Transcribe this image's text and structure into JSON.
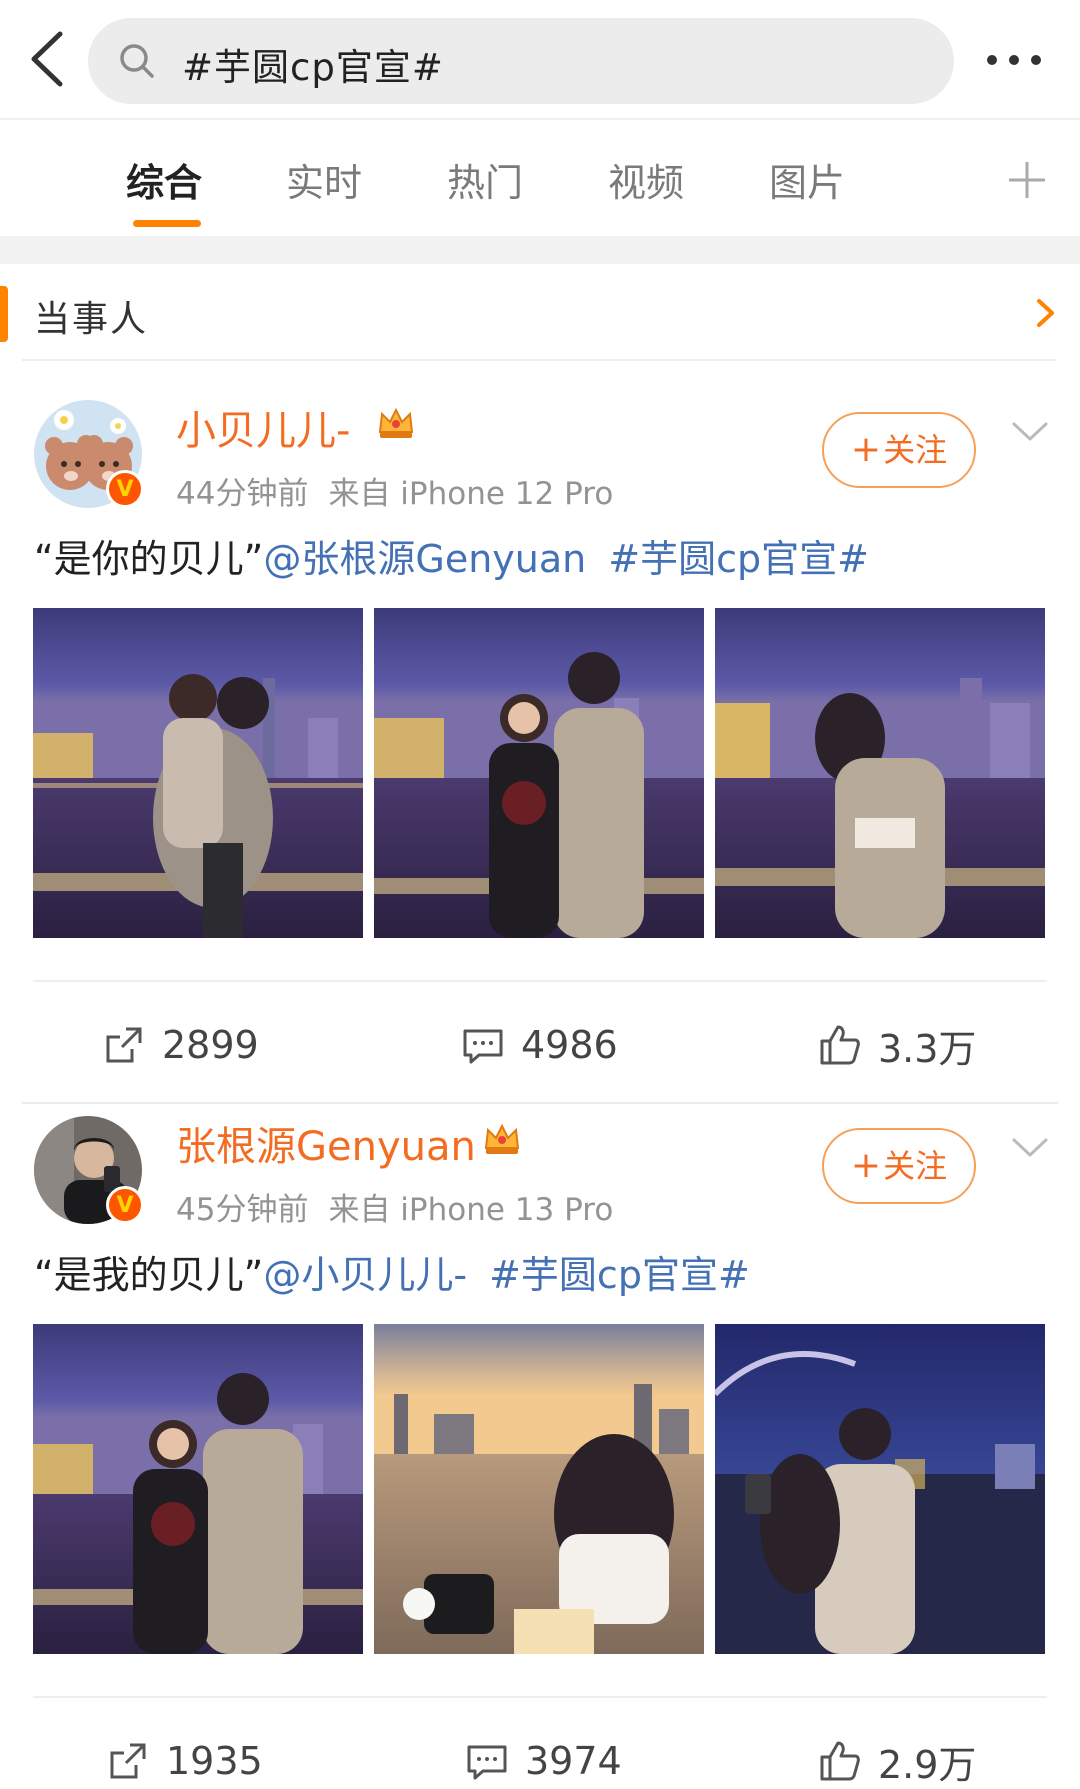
{
  "search": {
    "query": "#芋圆cp官宣#"
  },
  "tabs": [
    {
      "label": "综合",
      "active": true
    },
    {
      "label": "实时",
      "active": false
    },
    {
      "label": "热门",
      "active": false
    },
    {
      "label": "视频",
      "active": false
    },
    {
      "label": "图片",
      "active": false
    }
  ],
  "section": {
    "title": "当事人"
  },
  "posts": [
    {
      "username": "小贝儿儿-",
      "time": "44分钟前",
      "source": "来自 iPhone 12 Pro",
      "follow_label": "关注",
      "text_quote": "“是你的贝儿”",
      "mention": "@张根源Genyuan",
      "hashtag": "#芋圆cp官宣#",
      "reposts": "2899",
      "comments": "4986",
      "likes": "3.3万"
    },
    {
      "username": "张根源Genyuan",
      "time": "45分钟前",
      "source": "来自 iPhone 13 Pro",
      "follow_label": "关注",
      "text_quote": "“是我的贝儿”",
      "mention": "@小贝儿儿-",
      "hashtag": "#芋圆cp官宣#",
      "reposts": "1935",
      "comments": "3974",
      "likes": "2.9万"
    }
  ],
  "colors": {
    "accent": "#ff8200",
    "username": "#f36c21",
    "link": "#4471b6",
    "verified": "#ff5400"
  },
  "icons": [
    "back-icon",
    "search-icon",
    "more-icon",
    "plus-icon",
    "chevron-right-icon",
    "chevron-down-icon",
    "crown-icon",
    "verified-icon",
    "repost-icon",
    "comment-icon",
    "like-icon"
  ]
}
